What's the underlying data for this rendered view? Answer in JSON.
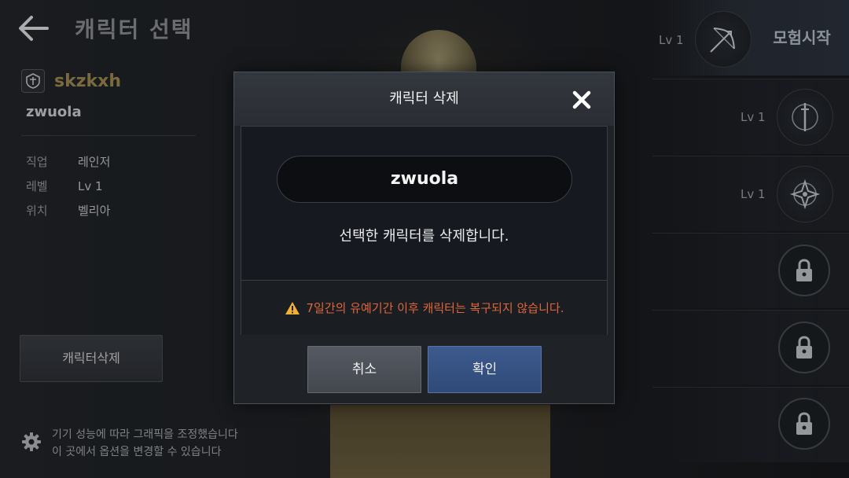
{
  "header": {
    "title": "캐릭터 선택",
    "back_icon": "back-arrow-icon"
  },
  "character": {
    "guild_emblem_icon": "guild-emblem-icon",
    "family_name": "skzkxh",
    "name": "zwuola",
    "info": [
      {
        "key": "직업",
        "value": "레인저"
      },
      {
        "key": "레벨",
        "value": "Lv 1"
      },
      {
        "key": "위치",
        "value": "벨리아"
      }
    ]
  },
  "left_panel": {
    "delete_button": "캐릭터삭제"
  },
  "footer": {
    "settings_icon": "gear-icon",
    "notice_line1": "기기 성능에 따라 그래픽을 조정했습니다",
    "notice_line2": "이 곳에서 옵션을 변경할 수 있습니다"
  },
  "slots": [
    {
      "level": "Lv 1",
      "icon": "bow-class-icon",
      "state": "selected"
    },
    {
      "level": "Lv 1",
      "icon": "blade-class-icon",
      "state": "available"
    },
    {
      "level": "Lv 1",
      "icon": "shuriken-class-icon",
      "state": "available"
    },
    {
      "level": "",
      "icon": "lock-icon",
      "state": "locked"
    },
    {
      "level": "",
      "icon": "lock-icon",
      "state": "locked"
    },
    {
      "level": "",
      "icon": "lock-icon",
      "state": "locked"
    }
  ],
  "start_button": "모험시작",
  "dialog": {
    "title": "캐릭터 삭제",
    "close_icon": "close-icon",
    "character_name": "zwuola",
    "message": "선택한 캐릭터를 삭제합니다.",
    "warning_icon": "warning-icon",
    "warning": "7일간의 유예기간 이후 캐릭터는 복구되지 않습니다.",
    "cancel_label": "취소",
    "confirm_label": "확인"
  },
  "colors": {
    "accent_gold": "#a48e52",
    "warning_orange": "#e0663a",
    "confirm_blue": "#3d5a8e"
  }
}
